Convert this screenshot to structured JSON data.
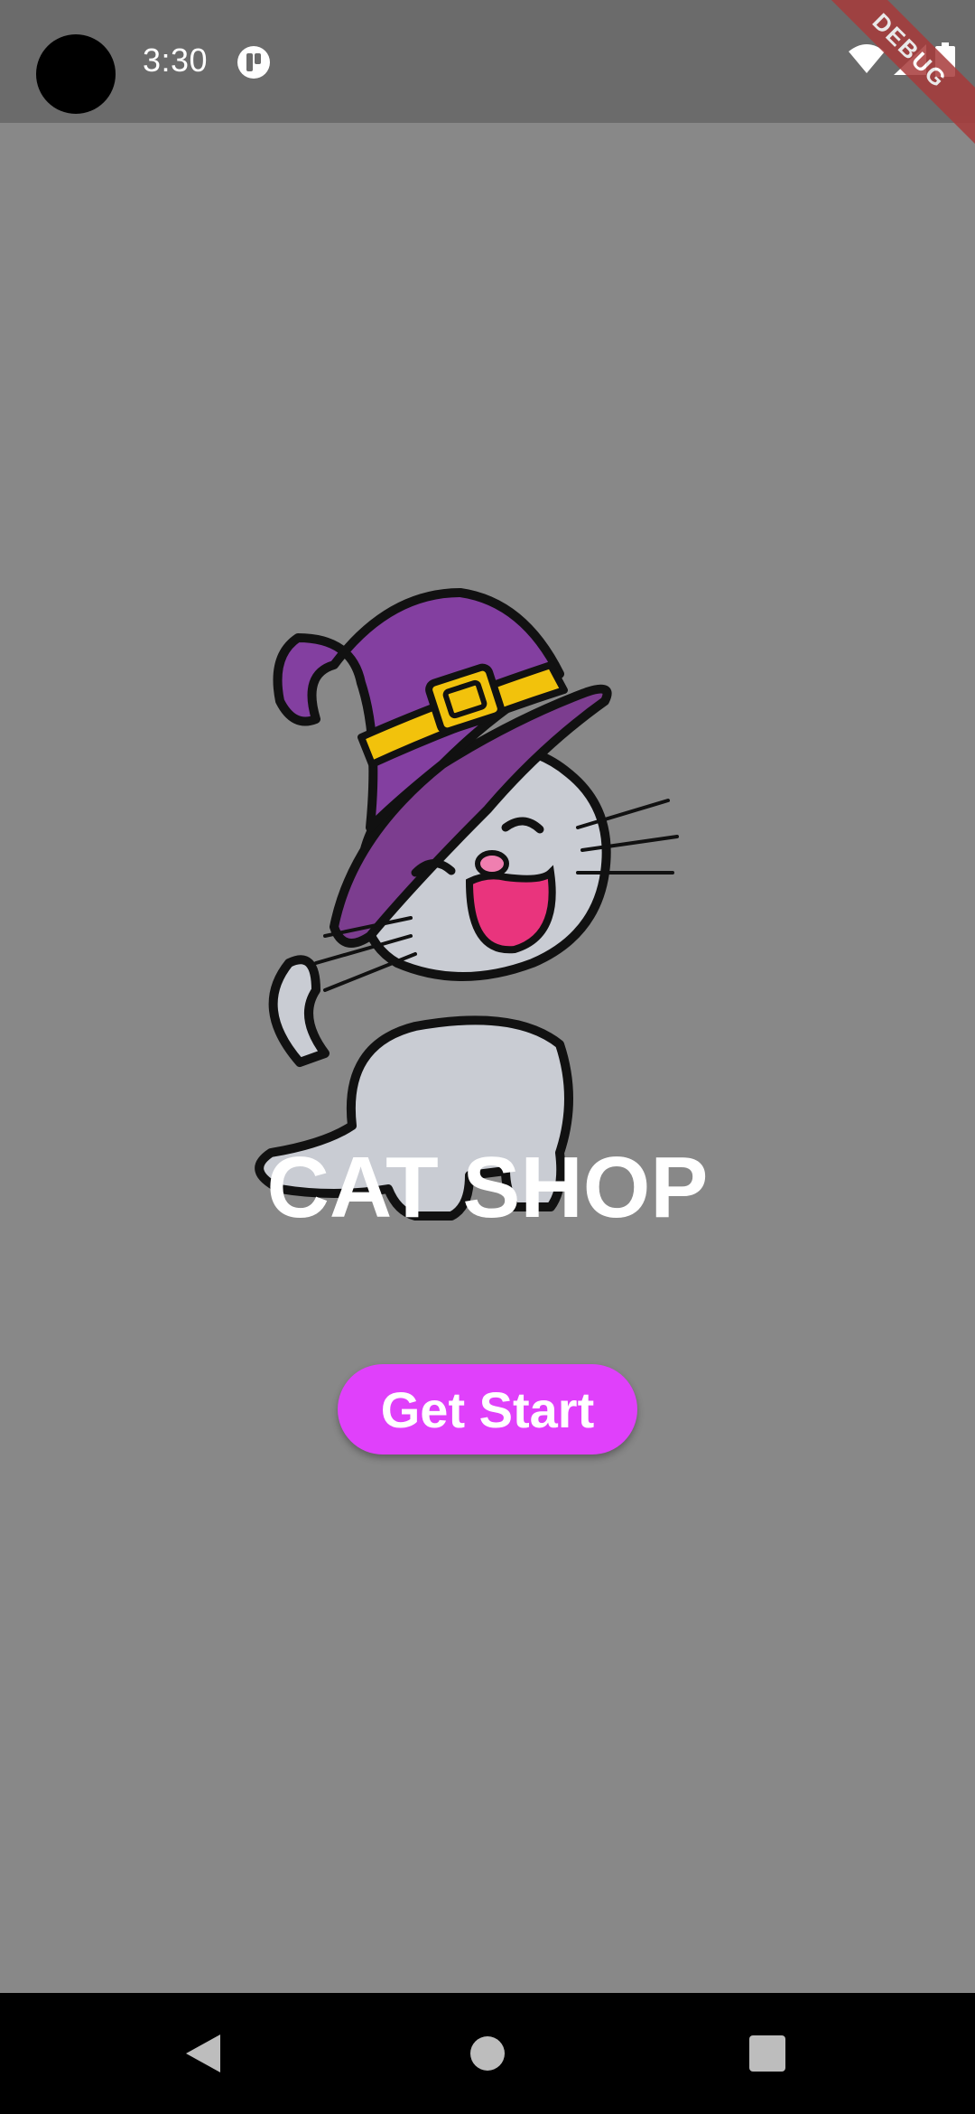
{
  "status_bar": {
    "time": "3:30",
    "debug_label": "DEBUG"
  },
  "main": {
    "title": "CAT SHOP",
    "button_label": "Get Start"
  },
  "colors": {
    "background": "#888888",
    "status_bar": "#6b6b6b",
    "button": "#e040fb",
    "title": "#ffffff"
  },
  "icons": {
    "status": [
      "wifi-icon",
      "signal-icon",
      "battery-icon"
    ],
    "nav": [
      "back-icon",
      "home-icon",
      "recents-icon"
    ]
  }
}
